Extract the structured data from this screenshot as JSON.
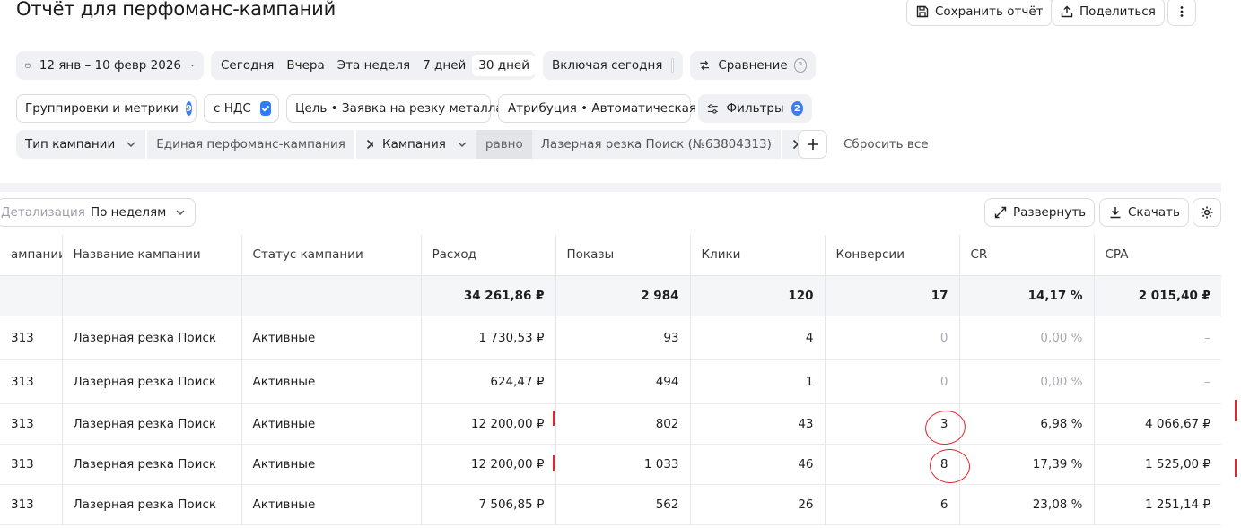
{
  "page": {
    "title": "Отчёт для перфоманс-кампаний"
  },
  "toolbar": {
    "save_label": "Сохранить отчёт",
    "share_label": "Поделиться"
  },
  "date_range": {
    "label": "12 янв – 10 февр 2026"
  },
  "periods": [
    "Сегодня",
    "Вчера",
    "Эта неделя",
    "7 дней",
    "30 дней"
  ],
  "active_period": "30 дней",
  "include_today": {
    "label": "Включая сегодня",
    "checked": false
  },
  "compare": {
    "label": "Сравнение"
  },
  "groupings": {
    "label": "Группировки и метрики",
    "count": "9"
  },
  "vat": {
    "label": "с НДС",
    "checked": true
  },
  "goal": {
    "label": "Цель • Заявка на резку металла"
  },
  "attribution": {
    "label": "Атрибуция • Автоматическая"
  },
  "filters": {
    "label": "Фильтры",
    "count": "2"
  },
  "filter1": {
    "field": "Тип кампании",
    "value": "Единая перфоманс-кампания"
  },
  "filter2": {
    "field": "Кампания",
    "op": "равно",
    "value": "Лазерная резка Поиск (№63804313)"
  },
  "reset_label": "Сбросить все",
  "detail": {
    "label": "Детализация",
    "value": "По неделям"
  },
  "expand_label": "Развернуть",
  "download_label": "Скачать",
  "table": {
    "headers": [
      "ампании ↓",
      "Название кампании",
      "Статус кампании",
      "Расход",
      "Показы",
      "Клики",
      "Конверсии",
      "CR",
      "CPA"
    ],
    "total": [
      "",
      "",
      "",
      "34 261,86 ₽",
      "2 984",
      "120",
      "17",
      "14,17 %",
      "2 015,40 ₽"
    ],
    "rows": [
      [
        "313",
        "Лазерная резка Поиск",
        "Активные",
        "1 730,53 ₽",
        "93",
        "4",
        "0",
        "0,00 %",
        "–"
      ],
      [
        "313",
        "Лазерная резка Поиск",
        "Активные",
        "624,47 ₽",
        "494",
        "1",
        "0",
        "0,00 %",
        "–"
      ],
      [
        "313",
        "Лазерная резка Поиск",
        "Активные",
        "12 200,00 ₽",
        "802",
        "43",
        "3",
        "6,98 %",
        "4 066,67 ₽"
      ],
      [
        "313",
        "Лазерная резка Поиск",
        "Активные",
        "12 200,00 ₽",
        "1 033",
        "46",
        "8",
        "17,39 %",
        "1 525,00 ₽"
      ],
      [
        "313",
        "Лазерная резка Поиск",
        "Активные",
        "7 506,85 ₽",
        "562",
        "26",
        "6",
        "23,08 %",
        "1 251,14 ₽"
      ]
    ]
  },
  "colors": {
    "accent": "#2f7cf6",
    "badge": "#3d7de8",
    "annotation": "#e4242b",
    "chip_bg": "#f0f1f4"
  }
}
